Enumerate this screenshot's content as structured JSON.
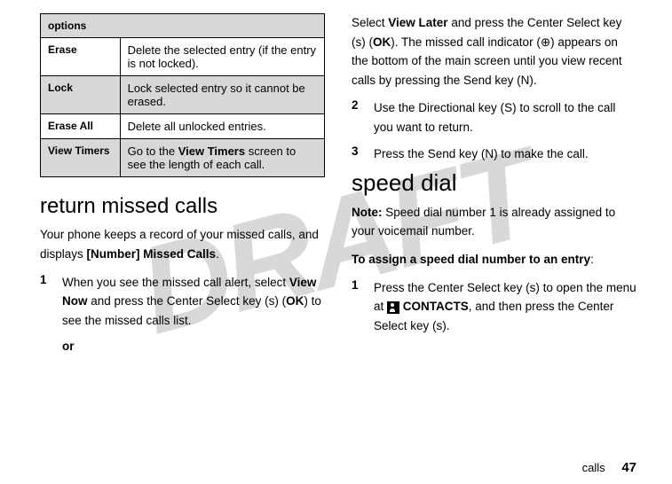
{
  "watermark": "DRAFT",
  "left": {
    "table": {
      "header": "options",
      "rows": [
        {
          "label": "Erase",
          "desc": "Delete the selected entry (if the entry is not locked).",
          "alt": false
        },
        {
          "label": "Lock",
          "desc": "Lock selected entry so it cannot be erased.",
          "alt": true
        },
        {
          "label": "Erase All",
          "desc": "Delete all unlocked entries.",
          "alt": false
        },
        {
          "label": "View Timers",
          "desc_pre": "Go to the ",
          "desc_bold": "View Timers",
          "desc_post": " screen to see the length of each call.",
          "alt": true
        }
      ]
    },
    "heading": "return missed calls",
    "intro_pre": "Your phone keeps a record of your missed calls, and displays ",
    "intro_bold": "[Number] Missed Calls",
    "intro_post": ".",
    "step1_pre": "When you see the missed call alert, select ",
    "step1_bold1": "View Now",
    "step1_mid": " and press the Center Select key (",
    "step1_sym1": "s",
    "step1_mid2": ") (",
    "step1_bold2": "OK",
    "step1_post": ") to see the missed calls list.",
    "or": "or",
    "step_num_1": "1"
  },
  "right": {
    "cont_pre": "Select ",
    "cont_bold1": "View Later",
    "cont_mid1": " and press the Center Select key (",
    "cont_sym1": "s",
    "cont_mid2": ") (",
    "cont_bold2": "OK",
    "cont_mid3": "). The missed call indicator (",
    "cont_sym2": "⊕",
    "cont_mid4": ") appears on the bottom of the main screen until you view recent calls by pressing the Send key (",
    "cont_sym3": "N",
    "cont_post": ").",
    "step2_num": "2",
    "step2_pre": "Use the Directional key (",
    "step2_sym": "S",
    "step2_post": ") to scroll to the call you want to return.",
    "step3_num": "3",
    "step3_pre": "Press the Send key (",
    "step3_sym": "N",
    "step3_post": ") to make the call.",
    "heading2": "speed dial",
    "note_label": "Note:",
    "note_text": " Speed dial number 1 is already assigned to your voicemail number.",
    "assign_bold": "To assign a speed dial number to an entry",
    "assign_post": ":",
    "sd_step1_num": "1",
    "sd_step1_pre": "Press the Center Select key (",
    "sd_step1_sym1": "s",
    "sd_step1_mid1": ") to open the menu at ",
    "sd_step1_bold": "CONTACTS",
    "sd_step1_mid2": ", and then press the Center Select key (",
    "sd_step1_sym2": "s",
    "sd_step1_post": ")."
  },
  "footer": {
    "label": "calls",
    "page": "47"
  }
}
